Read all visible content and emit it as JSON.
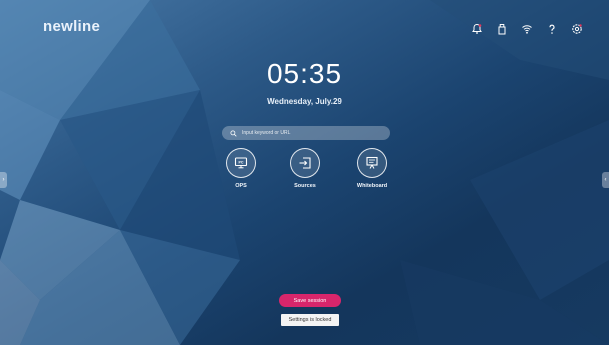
{
  "brand": "newline",
  "clock": {
    "time": "05:35",
    "date": "Wednesday, July.29"
  },
  "search": {
    "placeholder": "Input keyword or URL"
  },
  "apps": [
    {
      "label": "OPS",
      "icon": "pc-monitor-icon"
    },
    {
      "label": "Sources",
      "icon": "input-source-icon"
    },
    {
      "label": "Whiteboard",
      "icon": "whiteboard-icon"
    }
  ],
  "topbar_icons": [
    "notification-bell-icon",
    "usb-drive-icon",
    "wifi-icon",
    "help-icon",
    "settings-icon"
  ],
  "save_session": "Save session",
  "settings_locked": "Settings is locked",
  "edge_tabs": {
    "left": "›",
    "right": "‹"
  },
  "colors": {
    "accent": "#d8266b",
    "background": "#1b4470"
  }
}
